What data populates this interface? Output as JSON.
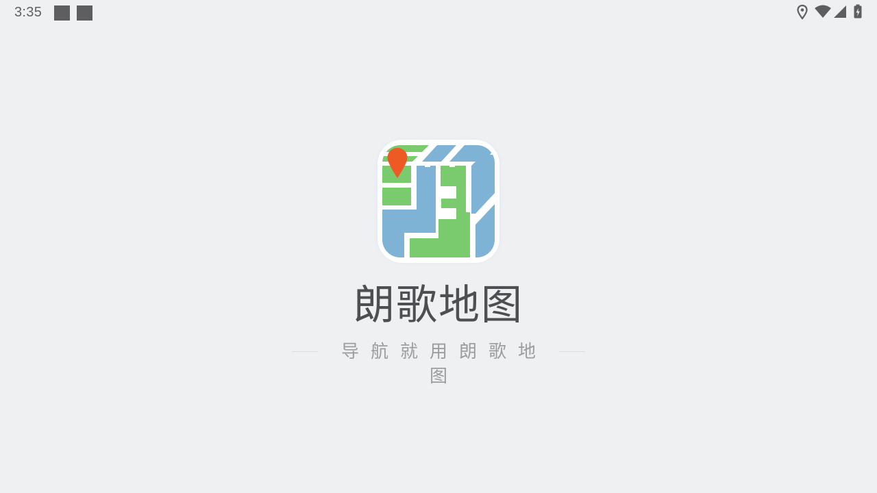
{
  "status_bar": {
    "time": "3:35",
    "notification_icons": [
      "notification-square-icon",
      "notification-square-icon"
    ],
    "system_icons": [
      "location-icon",
      "wifi-icon",
      "cellular-signal-icon",
      "battery-charging-icon"
    ]
  },
  "splash": {
    "app_name": "朗歌地图",
    "slogan": "导航就用朗歌地图",
    "logo_icon": "map-logo-icon",
    "colors": {
      "background": "#eff0f2",
      "map_green": "#7acb6d",
      "map_blue": "#7fb3d6",
      "pin_orange": "#ee5a24",
      "title_text": "#4e4f52",
      "slogan_text": "#9c9da0"
    }
  }
}
